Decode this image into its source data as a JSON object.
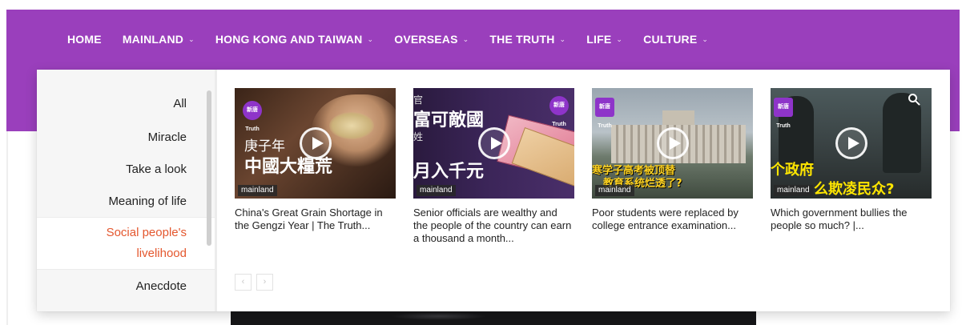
{
  "nav": {
    "items": [
      {
        "label": "HOME",
        "has_dropdown": false
      },
      {
        "label": "MAINLAND",
        "has_dropdown": true
      },
      {
        "label": "HONG KONG AND TAIWAN",
        "has_dropdown": true
      },
      {
        "label": "OVERSEAS",
        "has_dropdown": true
      },
      {
        "label": "THE TRUTH",
        "has_dropdown": true,
        "active": true
      },
      {
        "label": "LIFE",
        "has_dropdown": true
      },
      {
        "label": "CULTURE",
        "has_dropdown": true
      }
    ],
    "chevron": "⌄"
  },
  "categories": {
    "items": [
      {
        "label": "All"
      },
      {
        "label": "Miracle"
      },
      {
        "label": "Take a look"
      },
      {
        "label": "Meaning of life"
      },
      {
        "label": "Social people's",
        "label2": "livelihood",
        "active": true
      },
      {
        "label": "Anecdote"
      }
    ]
  },
  "cards": [
    {
      "tag": "mainland",
      "title": "China's Great Grain Shortage in the Gengzi Year | The Truth...",
      "overlay": [
        "庚子年",
        "中國大糧荒"
      ],
      "logo": "新唐 Truth"
    },
    {
      "tag": "mainland",
      "title": "Senior officials are wealthy and the people of the country can earn a thousand a month...",
      "overlay": [
        "富可敵國",
        "月入千元"
      ],
      "overlay_small": [
        "官",
        "姓"
      ],
      "logo": "新唐 Truth"
    },
    {
      "tag": "mainland",
      "title": "Poor students were replaced by college entrance examination...",
      "overlay": [
        "寒学子高考被顶替",
        "教育系统烂透了?"
      ],
      "logo": "新唐 Truth"
    },
    {
      "tag": "mainland",
      "title": "Which government bullies the people so much? |...",
      "overlay": [
        "个政府",
        "么欺凌民众?"
      ],
      "logo": "新唐 Truth"
    }
  ],
  "pager": {
    "prev": "‹",
    "next": "›"
  },
  "icons": {
    "play": "play-icon",
    "search": "search-icon",
    "chevron": "chevron-down-icon"
  },
  "colors": {
    "nav_bg": "#9a3fbc",
    "accent": "#e4572e",
    "logo": "#8e34c9"
  }
}
